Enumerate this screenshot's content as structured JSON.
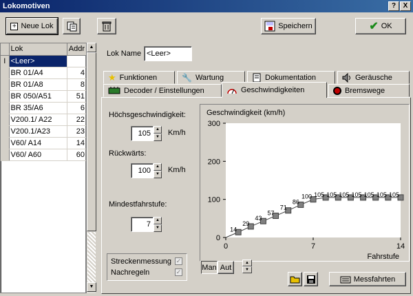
{
  "window": {
    "title": "Lokomotiven",
    "help": "?",
    "close": "X"
  },
  "toolbar": {
    "new_label": "Neue Lok",
    "save_label": "Speichern",
    "ok_label": "OK"
  },
  "list": {
    "headers": {
      "lok": "Lok",
      "addr": "Addr"
    },
    "row_marker": "I",
    "rows": [
      {
        "name": "<Leer>",
        "addr": ""
      },
      {
        "name": "BR 01/A4",
        "addr": "4"
      },
      {
        "name": "BR 01/A8",
        "addr": "8"
      },
      {
        "name": "BR 050/A51",
        "addr": "51"
      },
      {
        "name": "BR 35/A6",
        "addr": "6"
      },
      {
        "name": "V200.1/ A22",
        "addr": "22"
      },
      {
        "name": "V200.1/A23",
        "addr": "23"
      },
      {
        "name": "V60/ A14",
        "addr": "14"
      },
      {
        "name": "V60/ A60",
        "addr": "60"
      }
    ]
  },
  "lokname": {
    "label": "Lok Name",
    "value": "<Leer>"
  },
  "tabs": {
    "funktionen": "Funktionen",
    "wartung": "Wartung",
    "dokumentation": "Dokumentation",
    "geraeusche": "Geräusche",
    "decoder": "Decoder / Einstellungen",
    "geschwindigkeiten": "Geschwindigkeiten",
    "bremswege": "Bremswege"
  },
  "speed": {
    "max_label": "Höchsgeschwindigkeit:",
    "max_value": "105",
    "max_unit": "Km/h",
    "rev_label": "Rückwärts:",
    "rev_value": "100",
    "rev_unit": "Km/h",
    "min_label": "Mindestfahrstufe:",
    "min_value": "7"
  },
  "checks": {
    "strecke": "Streckenmessung",
    "nachregeln": "Nachregeln"
  },
  "mode": {
    "man": "Man",
    "aut": "Aut"
  },
  "measure_label": "Messfahrten",
  "colors": {
    "title_start": "#0a246a",
    "title_end": "#3a6ea5",
    "selection": "#0a246a",
    "point": "#808080",
    "line": "#404040"
  },
  "chart_data": {
    "type": "line",
    "title": "Geschwindigkeit (km/h)",
    "xlabel": "Fahrstufe",
    "ylabel": "Geschwindigkeit (km/h)",
    "xlim": [
      0,
      14
    ],
    "ylim": [
      0,
      300
    ],
    "yticks": [
      0,
      100,
      200,
      300
    ],
    "xticks": [
      0,
      7,
      14
    ],
    "x": [
      0,
      1,
      2,
      3,
      4,
      5,
      6,
      7,
      8,
      9,
      10,
      11,
      12,
      13,
      14
    ],
    "values": [
      0,
      14,
      29,
      43,
      57,
      71,
      86,
      100,
      105,
      105,
      105,
      105,
      105,
      105,
      105
    ],
    "point_labels": [
      "",
      "14",
      "29",
      "43",
      "57",
      "71",
      "86",
      "100",
      "105",
      "105",
      "105",
      "105",
      "105",
      "105",
      "105"
    ]
  }
}
